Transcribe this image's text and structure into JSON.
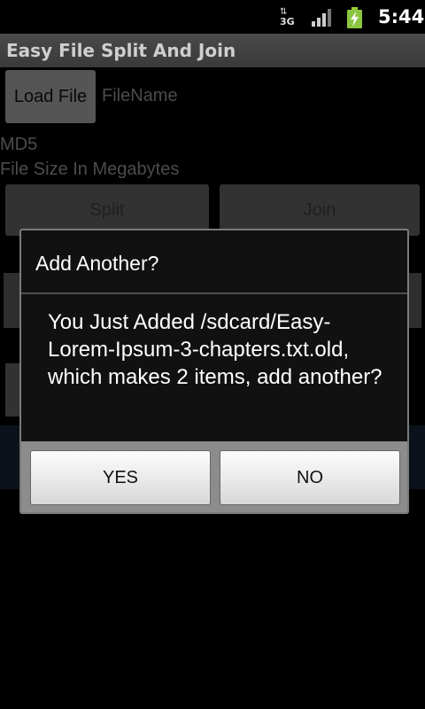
{
  "status_bar": {
    "network_type": "3G",
    "time": "5:44",
    "icons": [
      "network-3g-icon",
      "signal-icon",
      "battery-charging-icon"
    ]
  },
  "app": {
    "title": "Easy File Split And Join",
    "load_file_label": "Load File",
    "filename_label": "FileName",
    "md5_label": "MD5",
    "file_size_label": "File Size In Megabytes",
    "split_label": "Split",
    "join_label": "Join"
  },
  "dialog": {
    "title": "Add Another?",
    "message": "You Just Added /sdcard/Easy-Lorem-Ipsum-3-chapters.txt.old, which makes 2 items, add another?",
    "yes_label": "YES",
    "no_label": "NO"
  }
}
